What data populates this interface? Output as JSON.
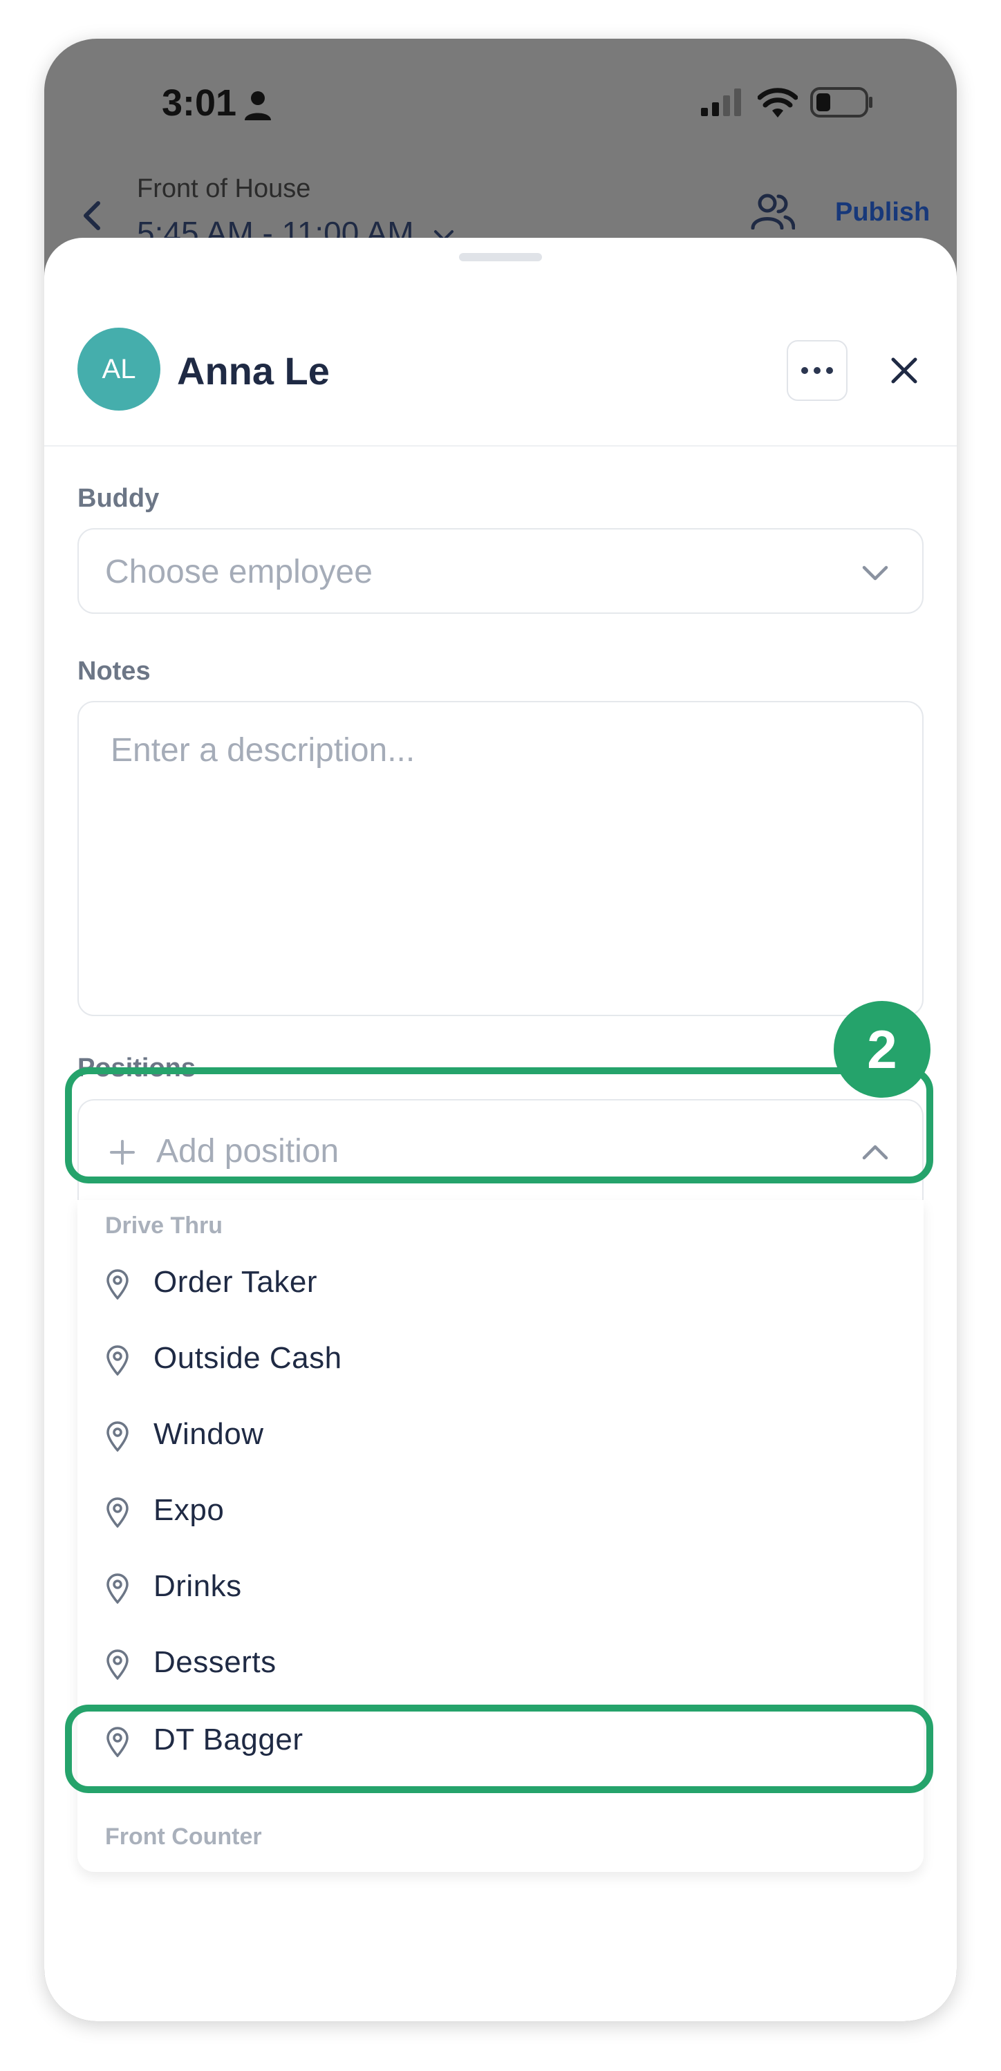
{
  "status_bar": {
    "time": "3:01"
  },
  "header": {
    "subtitle": "Front of House",
    "title": "5:45 AM - 11:00 AM",
    "publish_label": "Publish"
  },
  "sheet": {
    "avatar_initials": "AL",
    "employee_name": "Anna Le",
    "buddy": {
      "label": "Buddy",
      "placeholder": "Choose employee"
    },
    "notes": {
      "label": "Notes",
      "placeholder": "Enter a description..."
    },
    "positions": {
      "label": "Positions",
      "add_placeholder": "Add position",
      "groups": [
        {
          "name": "Drive Thru",
          "items": [
            "Order Taker",
            "Outside Cash",
            "Window",
            "Expo",
            "Drinks",
            "Desserts",
            "DT Bagger"
          ]
        },
        {
          "name": "Front Counter",
          "items": []
        }
      ]
    }
  },
  "annotation": {
    "step_number": "2",
    "color": "#25a36b"
  },
  "colors": {
    "accent_teal": "#45aeac",
    "publish_blue": "#17387a",
    "text_dark": "#1f2a44"
  }
}
